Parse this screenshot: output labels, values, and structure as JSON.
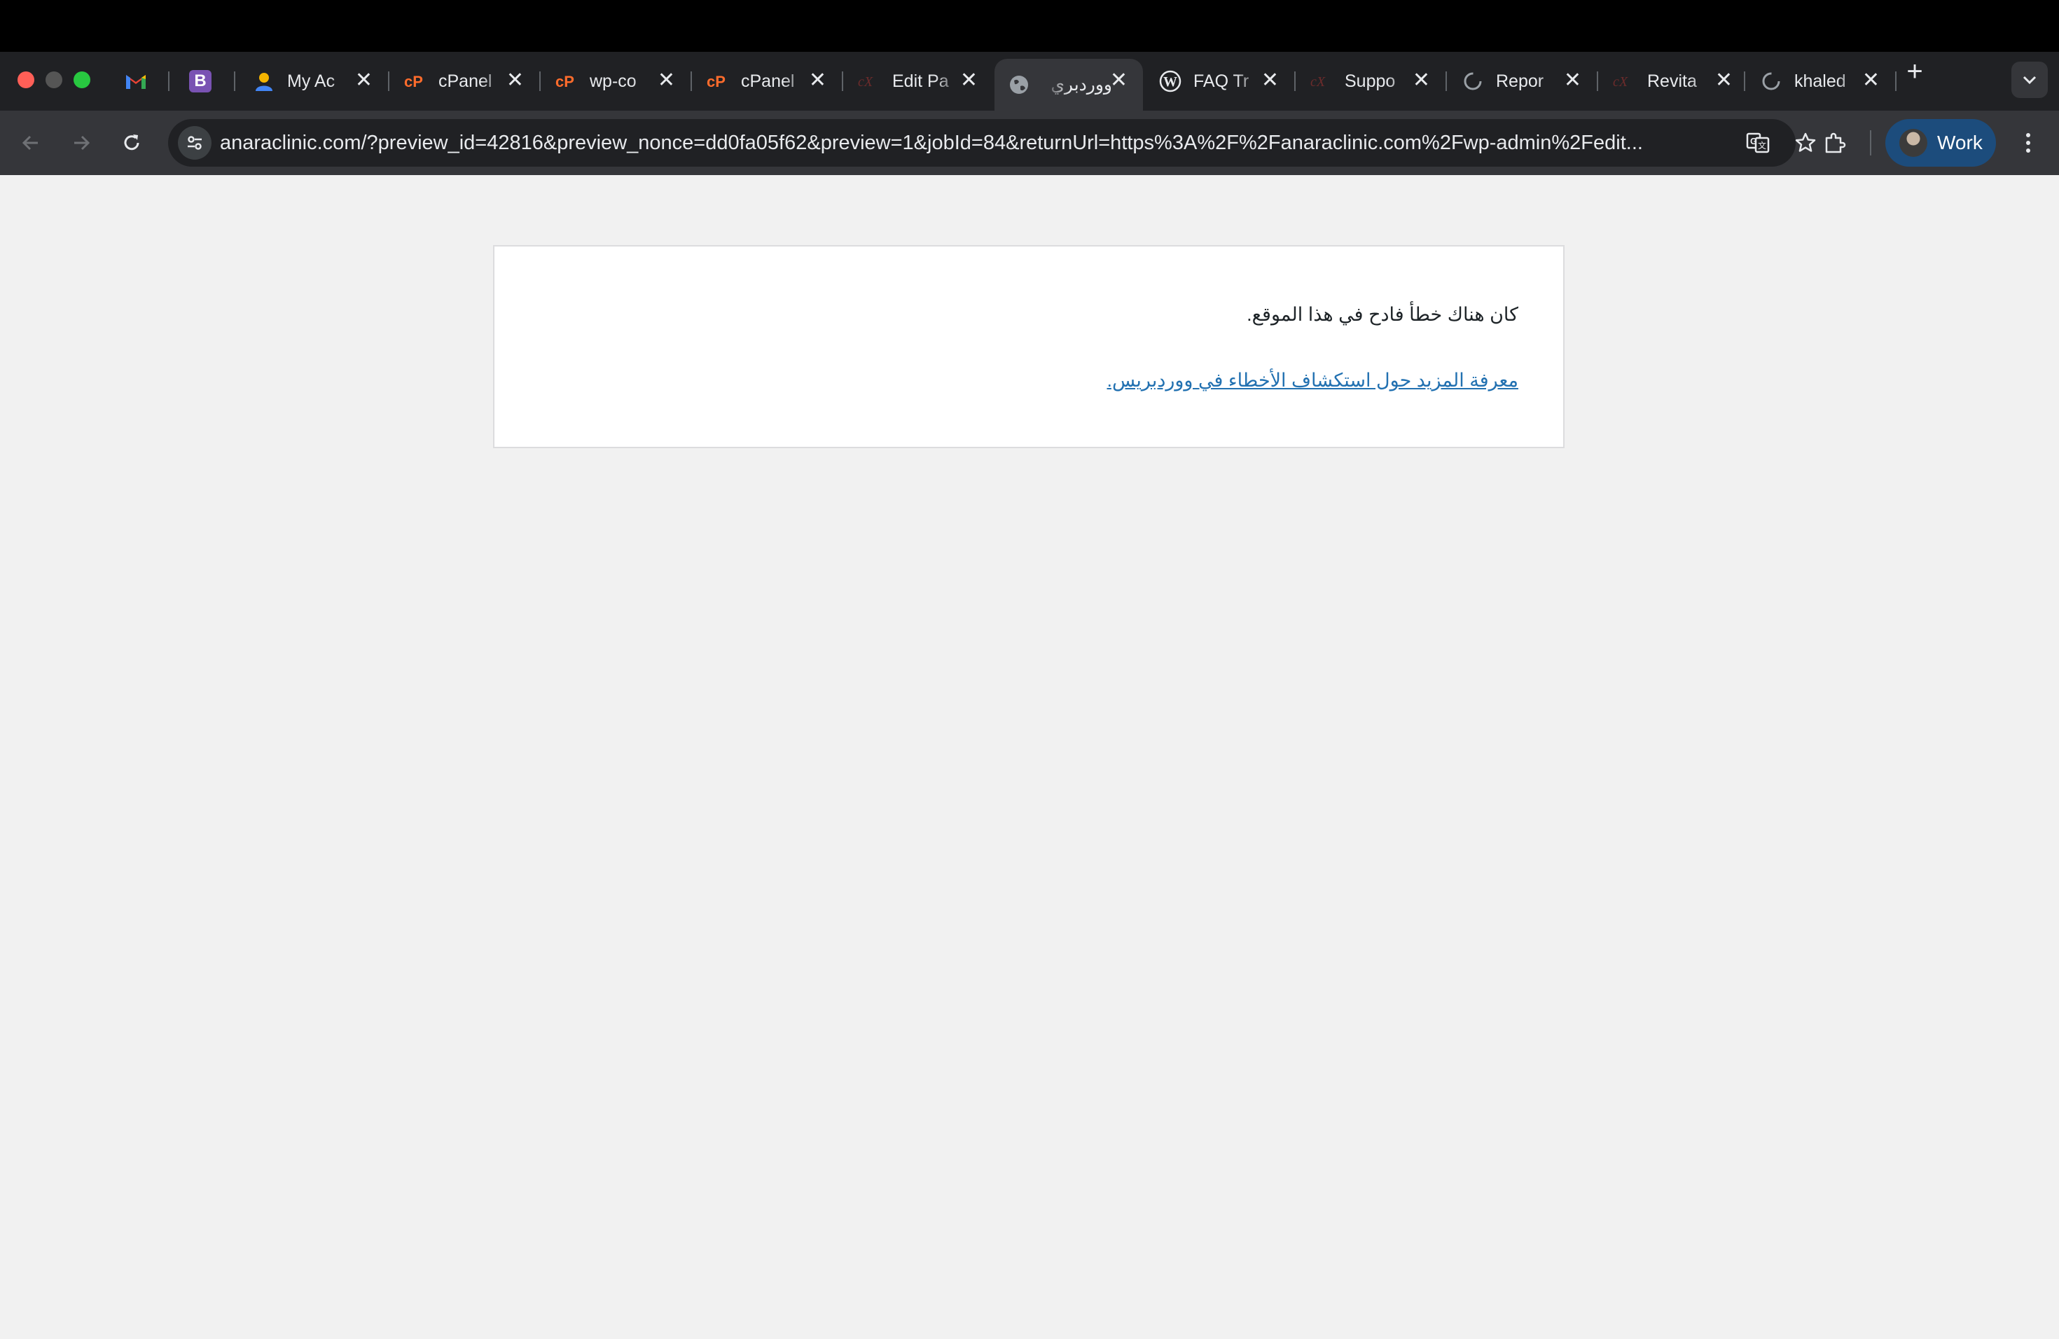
{
  "browser": {
    "tabs": [
      {
        "title": "My Ac",
        "icon": "user-icon",
        "active": false
      },
      {
        "title": "cPanel",
        "icon": "cpanel-icon",
        "active": false
      },
      {
        "title": "wp-co",
        "icon": "cpanel-icon",
        "active": false
      },
      {
        "title": "cPanel",
        "icon": "cpanel-icon",
        "active": false
      },
      {
        "title": "Edit Pa",
        "icon": "cx-icon",
        "active": false
      },
      {
        "title": "ووردبري",
        "icon": "globe-icon",
        "active": true
      },
      {
        "title": "FAQ Tr",
        "icon": "wordpress-icon",
        "active": false
      },
      {
        "title": "Suppo",
        "icon": "cx-icon",
        "active": false
      },
      {
        "title": "Repor",
        "icon": "loading-icon",
        "active": false
      },
      {
        "title": "Revita",
        "icon": "cx-icon",
        "active": false
      },
      {
        "title": "khaled",
        "icon": "loading-icon",
        "active": false
      }
    ],
    "close_glyph": "✕",
    "new_tab_glyph": "+",
    "url": "anaraclinic.com/?preview_id=42816&preview_nonce=dd0fa05f62&preview=1&jobId=84&returnUrl=https%3A%2F%2Fanaraclinic.com%2Fwp-admin%2Fedit...",
    "profile_label": "Work"
  },
  "page": {
    "error_message": "كان هناك خطأ فادح في هذا الموقع.",
    "help_link": "معرفة المزيد حول استكشاف الأخطاء في ووردبريس."
  },
  "colors": {
    "link": "#2271b1",
    "page_bg": "#f1f1f1"
  }
}
